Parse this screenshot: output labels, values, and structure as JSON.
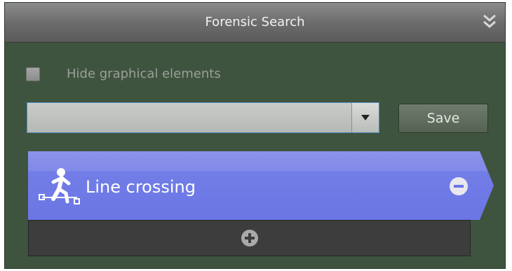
{
  "panel": {
    "title": "Forensic Search",
    "collapse_icon": "double-chevron-down-icon"
  },
  "options": {
    "hide_label": "Hide graphical elements",
    "hide_checked": false
  },
  "preset": {
    "selected_value": "",
    "save_label": "Save"
  },
  "criteria": [
    {
      "label": "Line crossing",
      "icon": "line-crossing-icon",
      "remove_icon": "minus-circle-icon",
      "color": "#7580e8"
    }
  ],
  "add_icon": "plus-circle-icon"
}
